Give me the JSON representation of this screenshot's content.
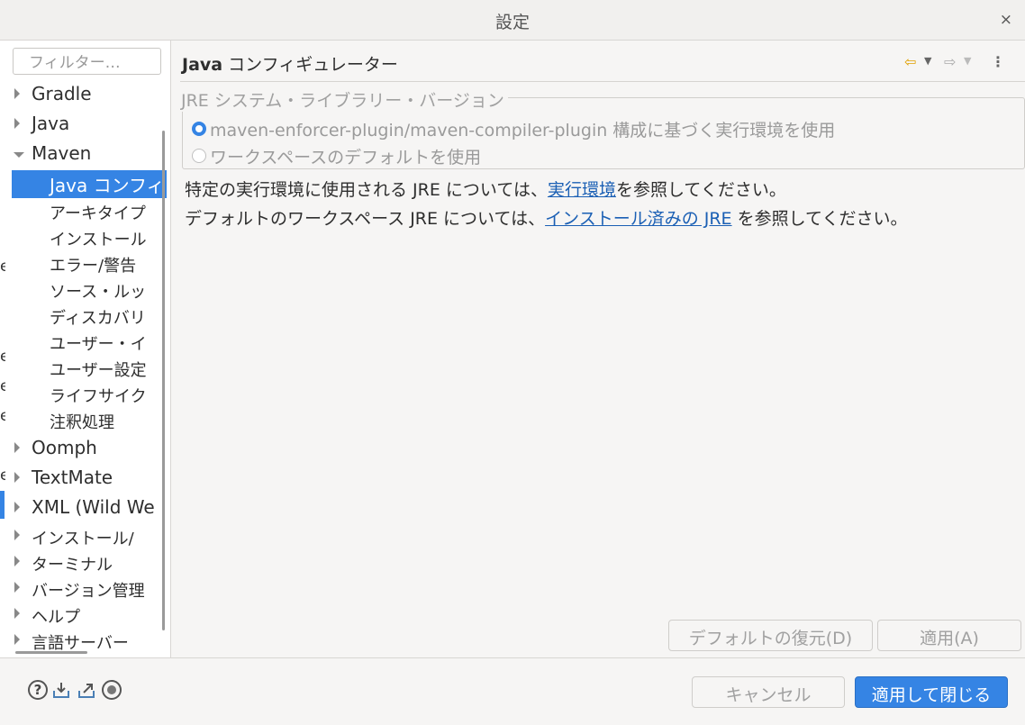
{
  "window": {
    "title": "設定",
    "close_glyph": "×"
  },
  "background_chars": [
    "e",
    "e",
    "e",
    "e",
    "e"
  ],
  "filter": {
    "placeholder": "フィルター…",
    "value": ""
  },
  "tree": [
    {
      "label": "Gradle",
      "state": "closed"
    },
    {
      "label": "Java",
      "state": "closed"
    },
    {
      "label": "Maven",
      "state": "open"
    },
    {
      "label": "Java コンフィ",
      "selected": true
    },
    {
      "label": "アーキタイプ"
    },
    {
      "label": "インストール"
    },
    {
      "label": "エラー/警告"
    },
    {
      "label": "ソース・ルッ"
    },
    {
      "label": "ディスカバリ"
    },
    {
      "label": "ユーザー・イ"
    },
    {
      "label": "ユーザー設定"
    },
    {
      "label": "ライフサイク"
    },
    {
      "label": "注釈処理"
    },
    {
      "label": "Oomph",
      "state": "closed"
    },
    {
      "label": "TextMate",
      "state": "closed"
    },
    {
      "label": "XML (Wild We",
      "state": "closed"
    },
    {
      "label": "インストール/",
      "state": "closed"
    },
    {
      "label": "ターミナル",
      "state": "closed"
    },
    {
      "label": "バージョン管理",
      "state": "closed"
    },
    {
      "label": "ヘルプ",
      "state": "closed"
    },
    {
      "label": "言語サーバー",
      "state": "closed"
    }
  ],
  "page": {
    "title_bold": "Java",
    "title_rest": " コンフィギュレーター",
    "group_label": "JRE システム・ライブラリー・バージョン",
    "radio1": {
      "label": "maven-enforcer-plugin/maven-compiler-plugin 構成に基づく実行環境を使用",
      "checked": true
    },
    "radio2": {
      "label": "ワークスペースのデフォルトを使用",
      "checked": false
    },
    "line1_pre": "特定の実行環境に使用される JRE については、",
    "line1_link": "実行環境",
    "line1_post": "を参照してください。",
    "line2_pre": "デフォルトのワークスペース JRE については、",
    "line2_link": "インストール済みの JRE",
    "line2_post": " を参照してください。",
    "restore_defaults": "デフォルトの復元(D)",
    "apply": "適用(A)"
  },
  "footer": {
    "cancel": "キャンセル",
    "apply_close": "適用して閉じる",
    "help_glyph": "?"
  },
  "colors": {
    "accent": "#3584e4",
    "link": "#1a5fb4"
  }
}
